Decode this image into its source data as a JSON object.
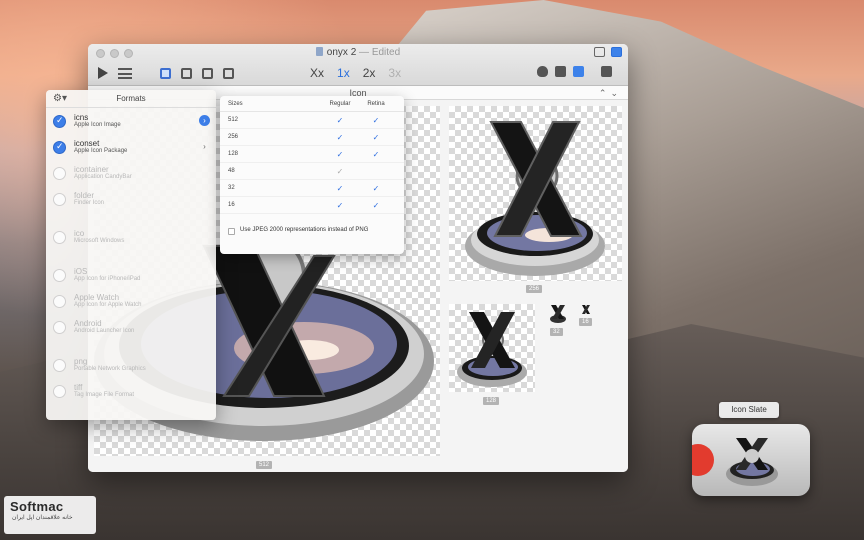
{
  "window": {
    "title": "onyx 2",
    "separator": "—",
    "status": "Edited",
    "zoom_options": [
      "Xx",
      "1x",
      "2x",
      "3x"
    ],
    "zoom_selected": "1x",
    "canvas_title": "Icon"
  },
  "formats_panel": {
    "title": "Formats",
    "items": [
      {
        "name": "icns",
        "desc": "Apple Icon Image",
        "checked": true
      },
      {
        "name": "iconset",
        "desc": "Apple Icon Package",
        "checked": true
      },
      {
        "name": "icontainer",
        "desc": "Application CandyBar",
        "checked": false
      },
      {
        "name": "folder",
        "desc": "Finder Icon",
        "checked": false
      },
      {
        "name": "ico",
        "desc": "Microsoft Windows",
        "checked": false
      },
      {
        "name": "iOS",
        "desc": "App Icon for iPhone/iPad",
        "checked": false
      },
      {
        "name": "Apple Watch",
        "desc": "App Icon for Apple Watch",
        "checked": false
      },
      {
        "name": "Android",
        "desc": "Android Launcher Icon",
        "checked": false
      },
      {
        "name": "png",
        "desc": "Portable Network Graphics",
        "checked": false
      },
      {
        "name": "tiff",
        "desc": "Tag Image File Format",
        "checked": false
      }
    ]
  },
  "sizes_panel": {
    "headers": [
      "Sizes",
      "Regular",
      "Retina"
    ],
    "rows": [
      {
        "size": "512",
        "regular": "✓",
        "retina": "✓"
      },
      {
        "size": "256",
        "regular": "✓",
        "retina": "✓"
      },
      {
        "size": "128",
        "regular": "✓",
        "retina": "✓"
      },
      {
        "size": "48",
        "regular": "✓",
        "retina": ""
      },
      {
        "size": "32",
        "regular": "✓",
        "retina": "✓"
      },
      {
        "size": "16",
        "regular": "✓",
        "retina": "✓"
      }
    ],
    "jpeg_option": "Use JPEG 2000 representations instead of PNG"
  },
  "preview_tags": [
    "512",
    "256",
    "128",
    "32",
    "16"
  ],
  "icon_slate": {
    "tooltip": "Icon Slate"
  },
  "watermark": {
    "brand": "Softmac",
    "subtitle": "خانه ‌علاقمندان اپل ایران"
  }
}
